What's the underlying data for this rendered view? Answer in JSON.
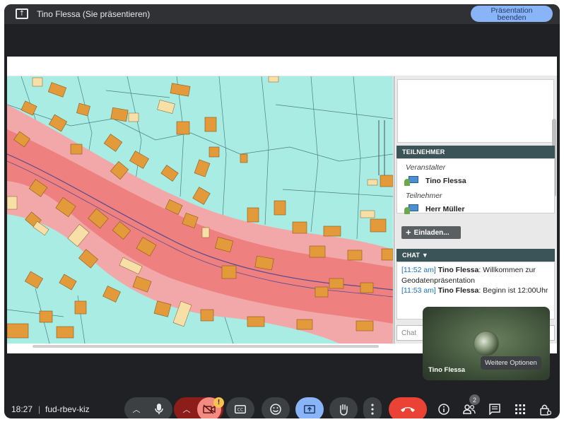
{
  "top_bar": {
    "present_title": "Tino Flessa (Sie präsentieren)",
    "stop_button": "Präsentation\nbeenden",
    "stop_button_color": "#8ab4f8"
  },
  "presentation": {
    "participants_header": "TEILNEHMER",
    "roles": [
      "Veranstalter",
      "Teilnehmer"
    ],
    "participants": [
      "Tino Flessa",
      "Herr Müller"
    ],
    "invite_button": "Einladen...",
    "chat_header": "CHAT ▼",
    "chat": [
      {
        "time": "[11:52 am]",
        "sender": "Tino Flessa",
        "text": ": Willkommen zur Geodatenpräsentation"
      },
      {
        "time": "[11:53 am]",
        "sender": "Tino Flessa",
        "text": ": Beginn ist 12:00Uhr"
      }
    ],
    "chat_input_placeholder": "Chat"
  },
  "self_view": {
    "name": "Tino Flessa",
    "more_options": "Weitere Optionen"
  },
  "bottom_bar": {
    "time": "18:27",
    "separator": "|",
    "meeting_code": "fud-rbev-kiz",
    "participant_count": "2",
    "warning_badge": "!",
    "icons": [
      "chevron-up-icon",
      "mic-icon",
      "chevron-up-icon",
      "camera-off-icon",
      "captions-icon",
      "emoji-icon",
      "present-icon",
      "raise-hand-icon",
      "more-vert-icon",
      "end-call-icon",
      "info-icon",
      "people-icon",
      "chat-icon",
      "activities-icon",
      "host-controls-icon"
    ],
    "end_call_color": "#ea4335",
    "present_active_color": "#8ab4f8",
    "camera_off_color": "#f28b82"
  }
}
